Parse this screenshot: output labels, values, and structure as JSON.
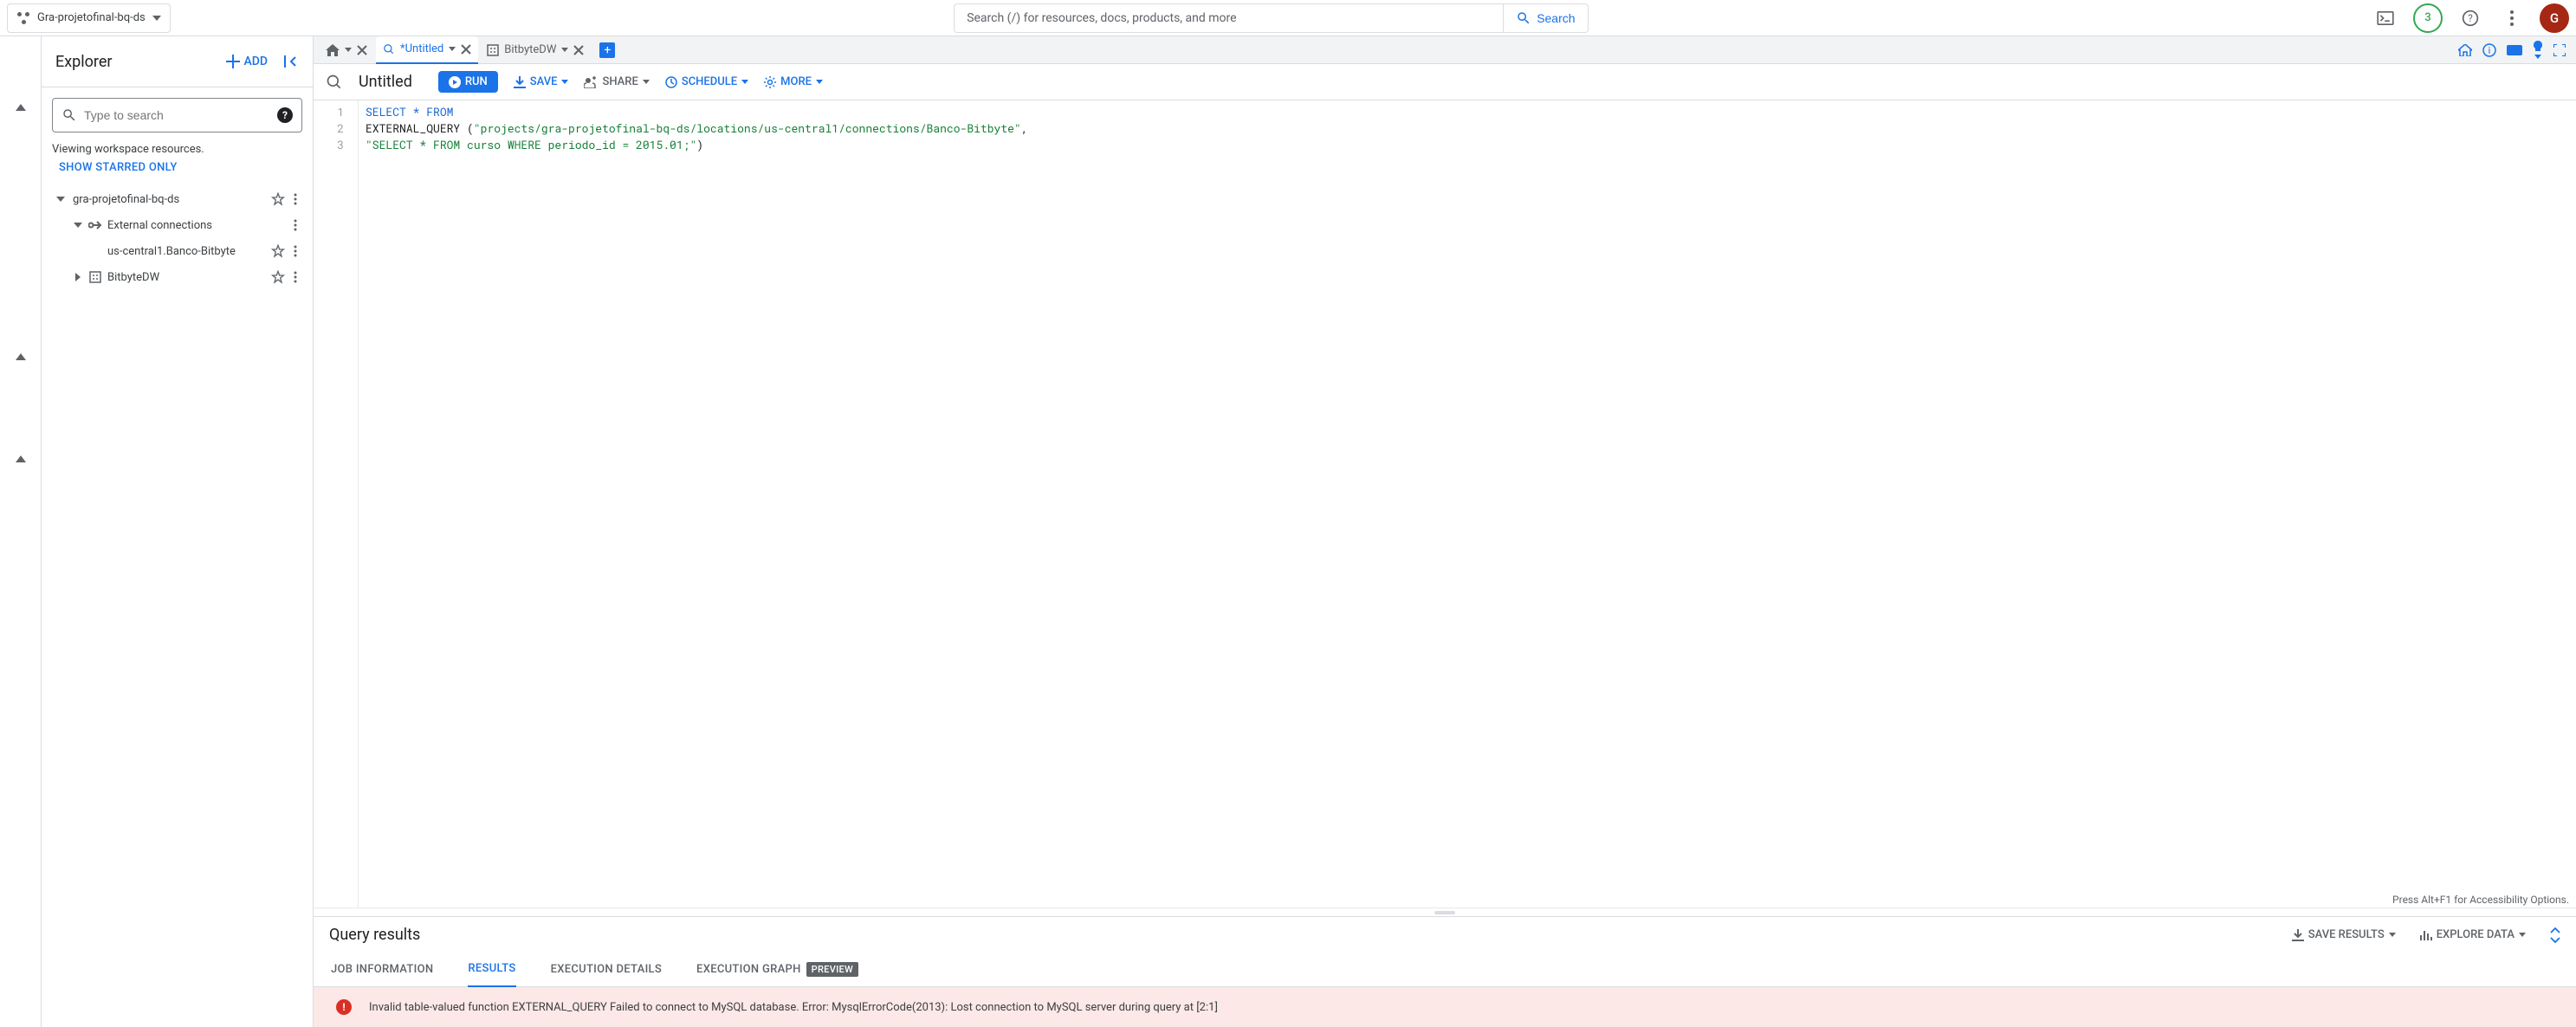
{
  "topbar": {
    "project_name": "Gra-projetofinal-bq-ds",
    "search_placeholder": "Search (/) for resources, docs, products, and more",
    "search_button": "Search",
    "trial_badge": "3",
    "avatar_initial": "G"
  },
  "explorer": {
    "title": "Explorer",
    "add_label": "ADD",
    "search_placeholder": "Type to search",
    "workspace_info": "Viewing workspace resources.",
    "starred_link": "SHOW STARRED ONLY",
    "tree": {
      "project": "gra-projetofinal-bq-ds",
      "external_connections": "External connections",
      "connection": "us-central1.Banco-Bitbyte",
      "dataset": "BitbyteDW"
    }
  },
  "tabs": {
    "home_label": "",
    "untitled_label": "*Untitled",
    "dataset_label": "BitbyteDW"
  },
  "toolbar": {
    "title": "Untitled",
    "run": "RUN",
    "save": "SAVE",
    "share": "SHARE",
    "schedule": "SCHEDULE",
    "more": "MORE"
  },
  "code": {
    "line1_kw1": "SELECT",
    "line1_kw2": "*",
    "line1_kw3": "FROM",
    "line2_fn": "EXTERNAL_QUERY",
    "line2_str": "\"projects/gra-projetofinal-bq-ds/locations/us-central1/connections/Banco-Bitbyte\"",
    "line3_str": "\"SELECT * FROM curso WHERE periodo_id = 2015.01;\"",
    "accessibility_hint": "Press Alt+F1 for Accessibility Options.",
    "gutter": [
      "1",
      "2",
      "3"
    ]
  },
  "results": {
    "title": "Query results",
    "save_results": "SAVE RESULTS",
    "explore_data": "EXPLORE DATA",
    "tabs": {
      "job_info": "JOB INFORMATION",
      "results": "RESULTS",
      "exec_details": "EXECUTION DETAILS",
      "exec_graph": "EXECUTION GRAPH",
      "preview_badge": "PREVIEW"
    },
    "error": "Invalid table-valued function EXTERNAL_QUERY Failed to connect to MySQL database. Error: MysqlErrorCode(2013): Lost connection to MySQL server during query at [2:1]"
  }
}
